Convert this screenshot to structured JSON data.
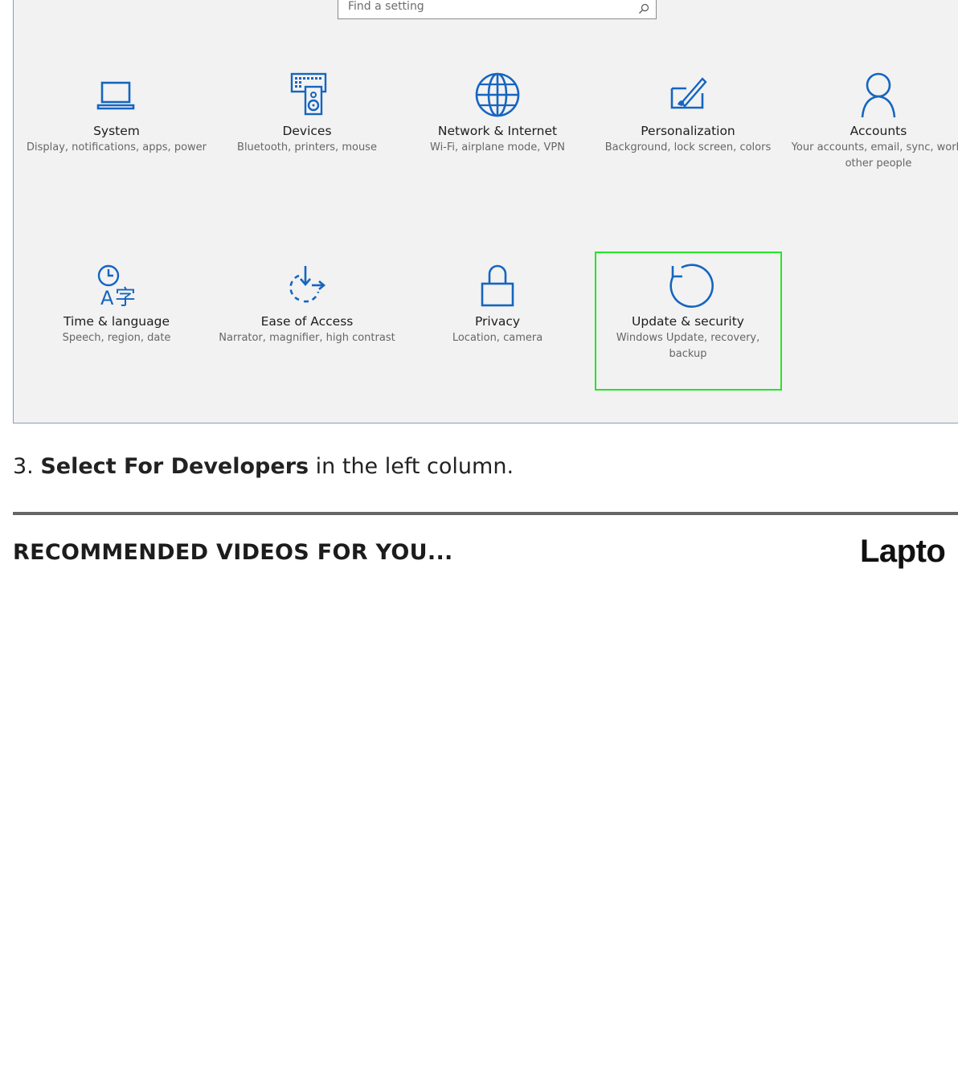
{
  "settings": {
    "search": {
      "placeholder": "Find a setting"
    },
    "tiles": [
      {
        "id": "system",
        "title": "System",
        "desc": "Display, notifications, apps, power",
        "icon": "laptop-icon"
      },
      {
        "id": "devices",
        "title": "Devices",
        "desc": "Bluetooth, printers, mouse",
        "icon": "devices-icon"
      },
      {
        "id": "network",
        "title": "Network & Internet",
        "desc": "Wi-Fi, airplane mode, VPN",
        "icon": "globe-icon"
      },
      {
        "id": "personalization",
        "title": "Personalization",
        "desc": "Background, lock screen, colors",
        "icon": "paint-tablet-icon"
      },
      {
        "id": "accounts",
        "title": "Accounts",
        "desc": "Your accounts, email, sync, work, other people",
        "icon": "person-icon"
      },
      {
        "id": "time-language",
        "title": "Time & language",
        "desc": "Speech, region, date",
        "icon": "time-language-icon"
      },
      {
        "id": "ease-of-access",
        "title": "Ease of Access",
        "desc": "Narrator, magnifier, high contrast",
        "icon": "ease-of-access-icon"
      },
      {
        "id": "privacy",
        "title": "Privacy",
        "desc": "Location, camera",
        "icon": "lock-icon"
      },
      {
        "id": "update-security",
        "title": "Update & security",
        "desc": "Windows Update, recovery, backup",
        "icon": "refresh-icon"
      }
    ],
    "highlighted_tile": "update-security",
    "icon_color": "#1565c0",
    "highlight_color": "#24e524"
  },
  "article": {
    "step_number": "3.",
    "step_bold": "Select For Developers",
    "step_rest": " in the left column."
  },
  "recommended": {
    "heading": "RECOMMENDED VIDEOS FOR YOU...",
    "brand": "Lapto"
  }
}
